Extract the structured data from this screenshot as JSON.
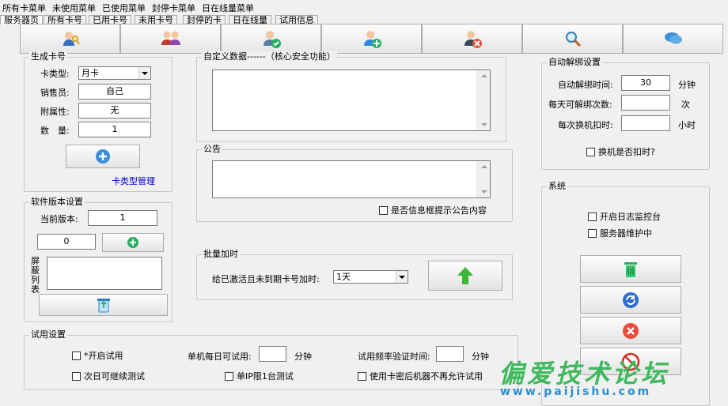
{
  "menu": [
    "所有卡菜单",
    "未使用菜单",
    "已使用菜单",
    "封停卡菜单",
    "日在线量菜单"
  ],
  "tabs": [
    "服务器页",
    "所有卡号",
    "已用卡号",
    "未用卡号",
    "封停的卡",
    "日在线量",
    "试用信息"
  ],
  "toolbar_icons": [
    "key-user-icon",
    "users-icon",
    "user-check-icon",
    "user-add-icon",
    "user-delete-icon",
    "magnifier-icon",
    "chat-icon"
  ],
  "generate": {
    "title": "生成卡号",
    "card_type_label": "卡类型:",
    "card_type_value": "月卡",
    "seller_label": "销售员:",
    "seller_value": "自己",
    "attr_label": "附属性:",
    "attr_value": "无",
    "qty_label": "数　量:",
    "qty_value": "1",
    "manage_link": "卡类型管理"
  },
  "custom_data": {
    "title": "自定义数据------（核心安全功能）"
  },
  "notice": {
    "title": "公告",
    "show_in_dialog": "是否信息框提示公告内容"
  },
  "autounbind": {
    "title": "自动解绑设置",
    "time_label": "自动解绑时间:",
    "time_value": "30",
    "time_unit": "分钟",
    "daily_label": "每天可解绑次数:",
    "daily_value": "",
    "daily_unit": "次",
    "deduct_label": "每次换机扣时:",
    "deduct_value": "",
    "deduct_unit": "小时",
    "deduct_check": "换机是否扣时?"
  },
  "version": {
    "title": "软件版本设置",
    "current_label": "当前版本:",
    "current_value": "1",
    "input_value": "0",
    "blocklist_label": [
      "屏",
      "蔽",
      "列",
      "表"
    ]
  },
  "batch": {
    "title": "批量加时",
    "label": "给已激活且未到期卡号加时:",
    "value": "1天"
  },
  "system": {
    "title": "系统",
    "log_monitor": "开启日志监控台",
    "maintenance": "服务器维护中"
  },
  "trial": {
    "title": "试用设置",
    "enable": "*开启试用",
    "next_day": "次日可继续测试",
    "daily_label": "单机每日可试用:",
    "daily_value": "",
    "daily_unit": "分钟",
    "one_ip": "单IP限1台测试",
    "freq_label": "试用频率验证时间:",
    "freq_value": "",
    "freq_unit": "分钟",
    "no_retry": "使用卡密后机器不再允许试用"
  },
  "watermark": {
    "title": "偏爱技术论坛",
    "url": "www.paijishu.com"
  },
  "colors": {
    "accent_green": "#3fb85e",
    "link_blue": "#0000cc",
    "watermark_blue": "#2a8fcf"
  }
}
